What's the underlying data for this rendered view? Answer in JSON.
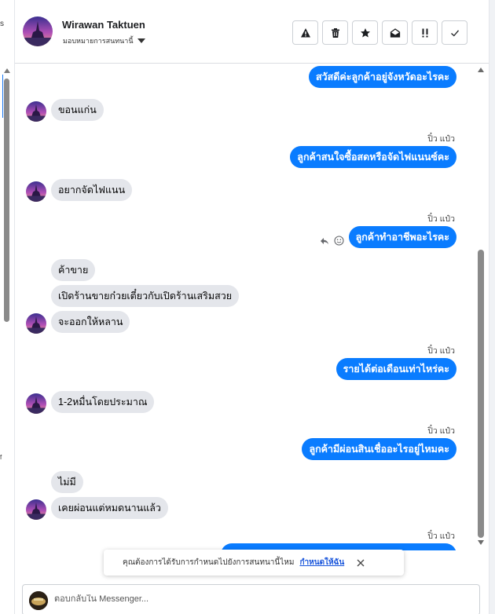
{
  "header": {
    "name": "Wirawan Taktuen",
    "assign_label": "มอบหมายการสนทนานี้",
    "actions": [
      {
        "icon": "warning-icon",
        "name": "spam-button"
      },
      {
        "icon": "trash-icon",
        "name": "delete-button"
      },
      {
        "icon": "star-icon",
        "name": "star-button"
      },
      {
        "icon": "envelope-open-icon",
        "name": "mark-unread-button"
      },
      {
        "icon": "double-exclamation-icon",
        "name": "follow-up-button"
      },
      {
        "icon": "checkmark-icon",
        "name": "done-button"
      }
    ]
  },
  "left_fragments": [
    "s",
    "f"
  ],
  "messages": [
    {
      "dir": "out",
      "text": "สวัสดีค่ะลูกค้าอยู่จังหวัดอะไรคะ",
      "sender": ""
    },
    {
      "dir": "in",
      "text": "ขอนแก่น",
      "avatar": true
    },
    {
      "dir": "out",
      "text": "ลูกค้าสนใจซื้อสดหรือจัดไฟแนนซ์คะ",
      "sender": "ปิ๋ว แป๋ว"
    },
    {
      "dir": "in",
      "text": "อยากจัดไฟแนน",
      "avatar": true
    },
    {
      "dir": "out",
      "text": "ลูกค้าทำอาชีพอะไรคะ",
      "sender": "ปิ๋ว แป๋ว",
      "reactions": true
    },
    {
      "dir": "in",
      "text": "ค้าขาย",
      "avatar": false
    },
    {
      "dir": "in",
      "text": "เปิดร้านขายก๋วยเตี๋ยวกับเปิดร้านเสริมสวย",
      "avatar": false
    },
    {
      "dir": "in",
      "text": "จะออกให้หลาน",
      "avatar": true
    },
    {
      "dir": "out",
      "text": "รายได้ต่อเดือนเท่าไหร่คะ",
      "sender": "ปิ๋ว แป๋ว"
    },
    {
      "dir": "in",
      "text": "1-2หมื่นโดยประมาณ",
      "avatar": true
    },
    {
      "dir": "out",
      "text": "ลูกค้ามีผ่อนสินเชื่ออะไรอยู่ไหมคะ",
      "sender": "ปิ๋ว แป๋ว"
    },
    {
      "dir": "in",
      "text": "ไม่มี",
      "avatar": false
    },
    {
      "dir": "in",
      "text": "เคยผ่อนแต่หมดนานแล้ว",
      "avatar": true
    },
    {
      "dir": "out",
      "text": "",
      "sender": "ปิ๋ว แป๋ว"
    }
  ],
  "notice": {
    "text": "คุณต้องการได้รับการกำหนดไปยังการสนทนานี้ไหม",
    "link": "กำหนดให้ฉัน"
  },
  "reply": {
    "placeholder": "ตอบกลับใน Messenger..."
  }
}
